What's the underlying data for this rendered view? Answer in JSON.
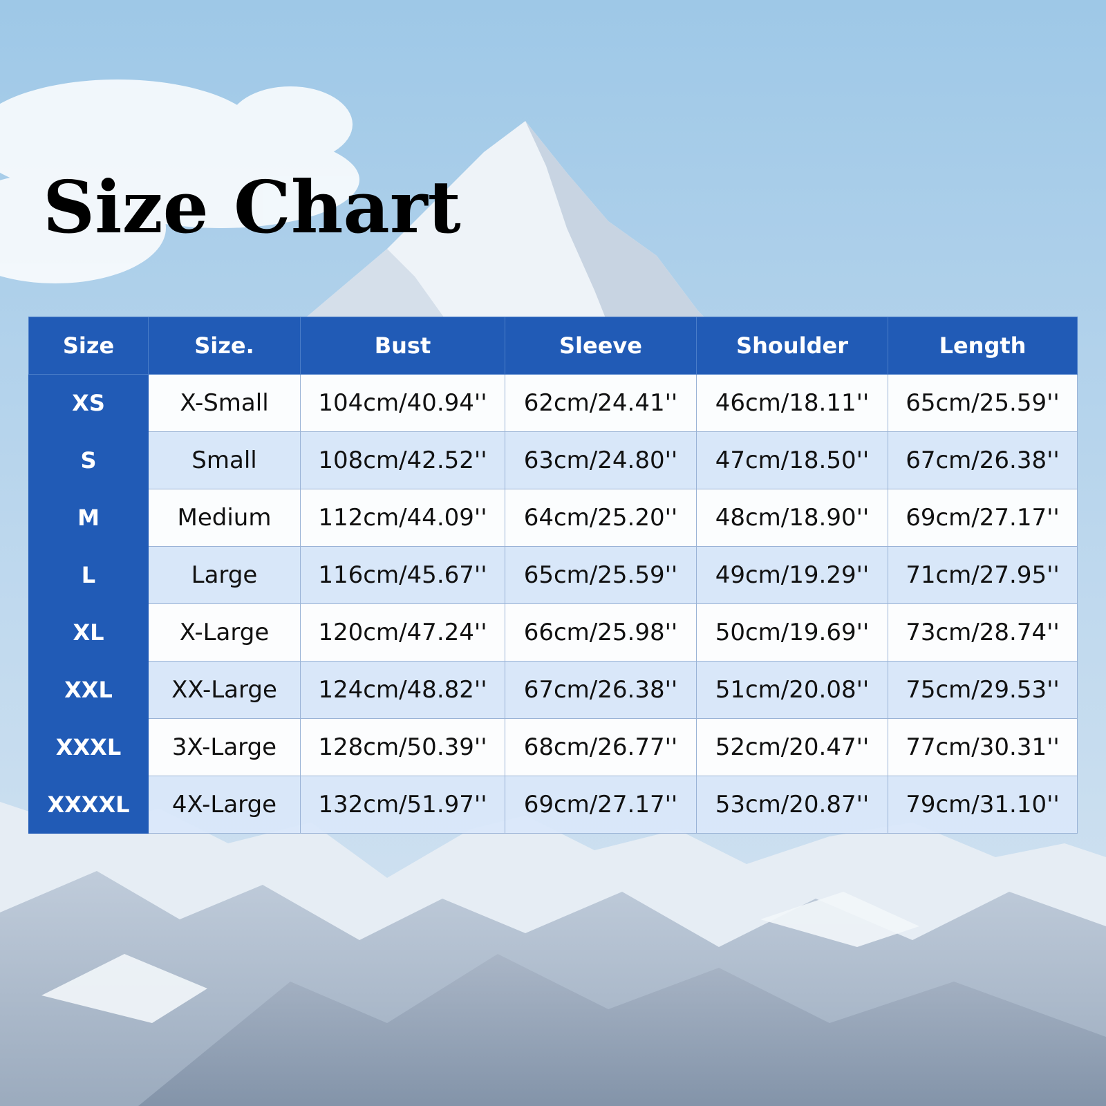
{
  "title": "Size Chart",
  "colors": {
    "header_blue": "#215bb6",
    "row_light": "#ffffff",
    "row_tint": "#dae8fa",
    "sky": "#9ec7e6"
  },
  "background": "snowy-mountain-photo",
  "table": {
    "headers": [
      "Size",
      "Size.",
      "Bust",
      "Sleeve",
      "Shoulder",
      "Length"
    ],
    "rows": [
      {
        "size": "XS",
        "name": "X-Small",
        "bust": "104cm/40.94''",
        "sleeve": "62cm/24.41''",
        "shoulder": "46cm/18.11''",
        "length": "65cm/25.59''"
      },
      {
        "size": "S",
        "name": "Small",
        "bust": "108cm/42.52''",
        "sleeve": "63cm/24.80''",
        "shoulder": "47cm/18.50''",
        "length": "67cm/26.38''"
      },
      {
        "size": "M",
        "name": "Medium",
        "bust": "112cm/44.09''",
        "sleeve": "64cm/25.20''",
        "shoulder": "48cm/18.90''",
        "length": "69cm/27.17''"
      },
      {
        "size": "L",
        "name": "Large",
        "bust": "116cm/45.67''",
        "sleeve": "65cm/25.59''",
        "shoulder": "49cm/19.29''",
        "length": "71cm/27.95''"
      },
      {
        "size": "XL",
        "name": "X-Large",
        "bust": "120cm/47.24''",
        "sleeve": "66cm/25.98''",
        "shoulder": "50cm/19.69''",
        "length": "73cm/28.74''"
      },
      {
        "size": "XXL",
        "name": "XX-Large",
        "bust": "124cm/48.82''",
        "sleeve": "67cm/26.38''",
        "shoulder": "51cm/20.08''",
        "length": "75cm/29.53''"
      },
      {
        "size": "XXXL",
        "name": "3X-Large",
        "bust": "128cm/50.39''",
        "sleeve": "68cm/26.77''",
        "shoulder": "52cm/20.47''",
        "length": "77cm/30.31''"
      },
      {
        "size": "XXXXL",
        "name": "4X-Large",
        "bust": "132cm/51.97''",
        "sleeve": "69cm/27.17''",
        "shoulder": "53cm/20.87''",
        "length": "79cm/31.10''"
      }
    ]
  }
}
